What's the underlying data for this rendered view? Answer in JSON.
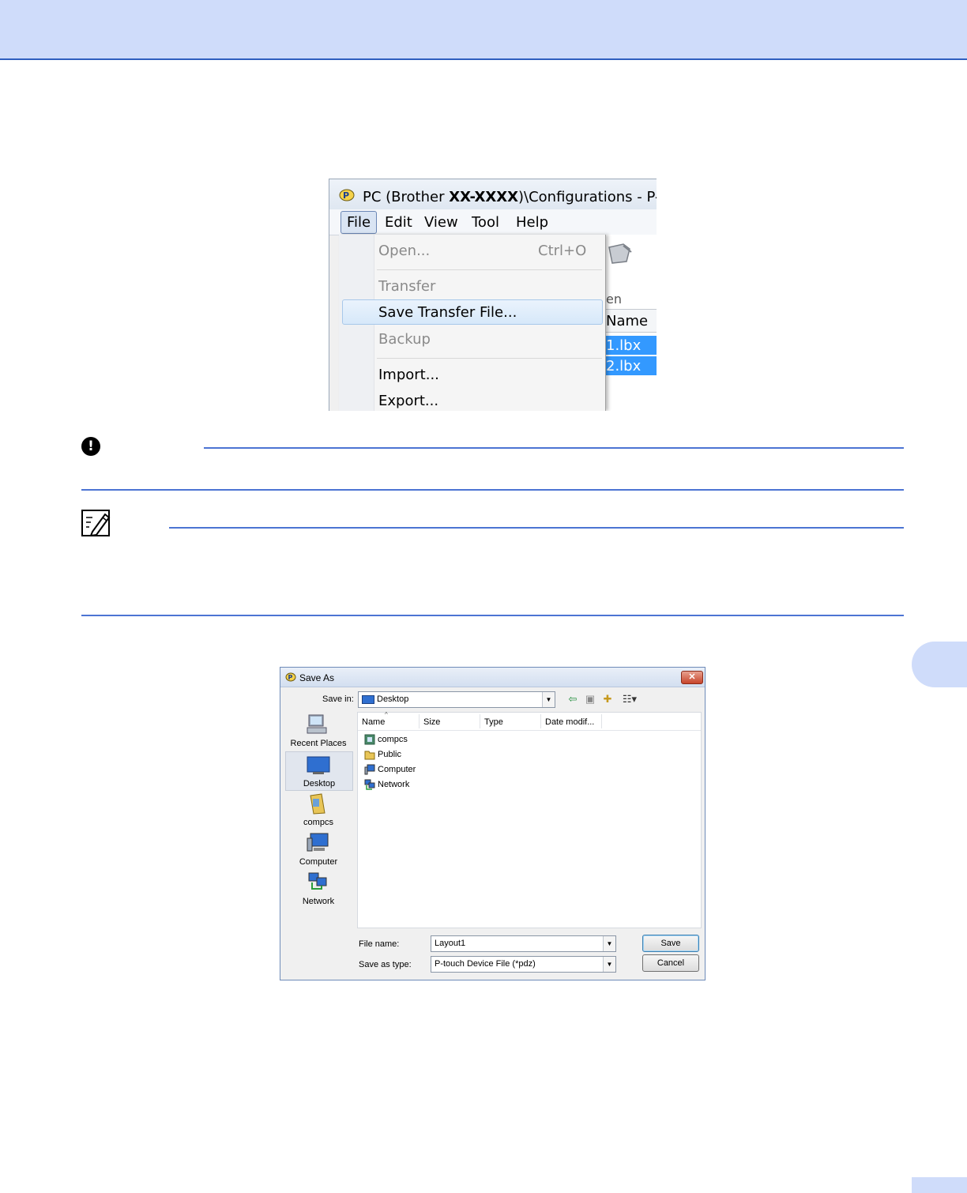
{
  "screenshot1": {
    "title_prefix": "PC (Brother ",
    "title_model": "XX-XXXX",
    "title_suffix": ")\\Configurations - P-tou",
    "menubar": [
      "File",
      "Edit",
      "View",
      "Tool",
      "Help"
    ],
    "file_menu": {
      "open": "Open...",
      "open_shortcut": "Ctrl+O",
      "transfer": "Transfer",
      "save_transfer_file": "Save Transfer File...",
      "backup": "Backup",
      "import": "Import...",
      "export": "Export..."
    },
    "toolbar_label_fragment": "en",
    "column_header_fragment": "Name",
    "selected_rows": [
      "1.lbx",
      "2.lbx"
    ]
  },
  "important_icon": "!",
  "save_as_dialog": {
    "title": "Save As",
    "save_in_label": "Save in:",
    "save_in_value": "Desktop",
    "places": [
      "Recent Places",
      "Desktop",
      "compcs",
      "Computer",
      "Network"
    ],
    "columns": [
      "Name",
      "Size",
      "Type",
      "Date modif..."
    ],
    "items": [
      "compcs",
      "Public",
      "Computer",
      "Network"
    ],
    "file_name_label": "File name:",
    "file_name_value": "Layout1",
    "save_as_type_label": "Save as type:",
    "save_as_type_value": "P-touch Device File (*pdz)",
    "save_button": "Save",
    "cancel_button": "Cancel",
    "close_glyph": "✕"
  },
  "colors": {
    "header_band": "#cfdcfa",
    "rule": "#4c74d3",
    "selection": "#3399ff"
  }
}
